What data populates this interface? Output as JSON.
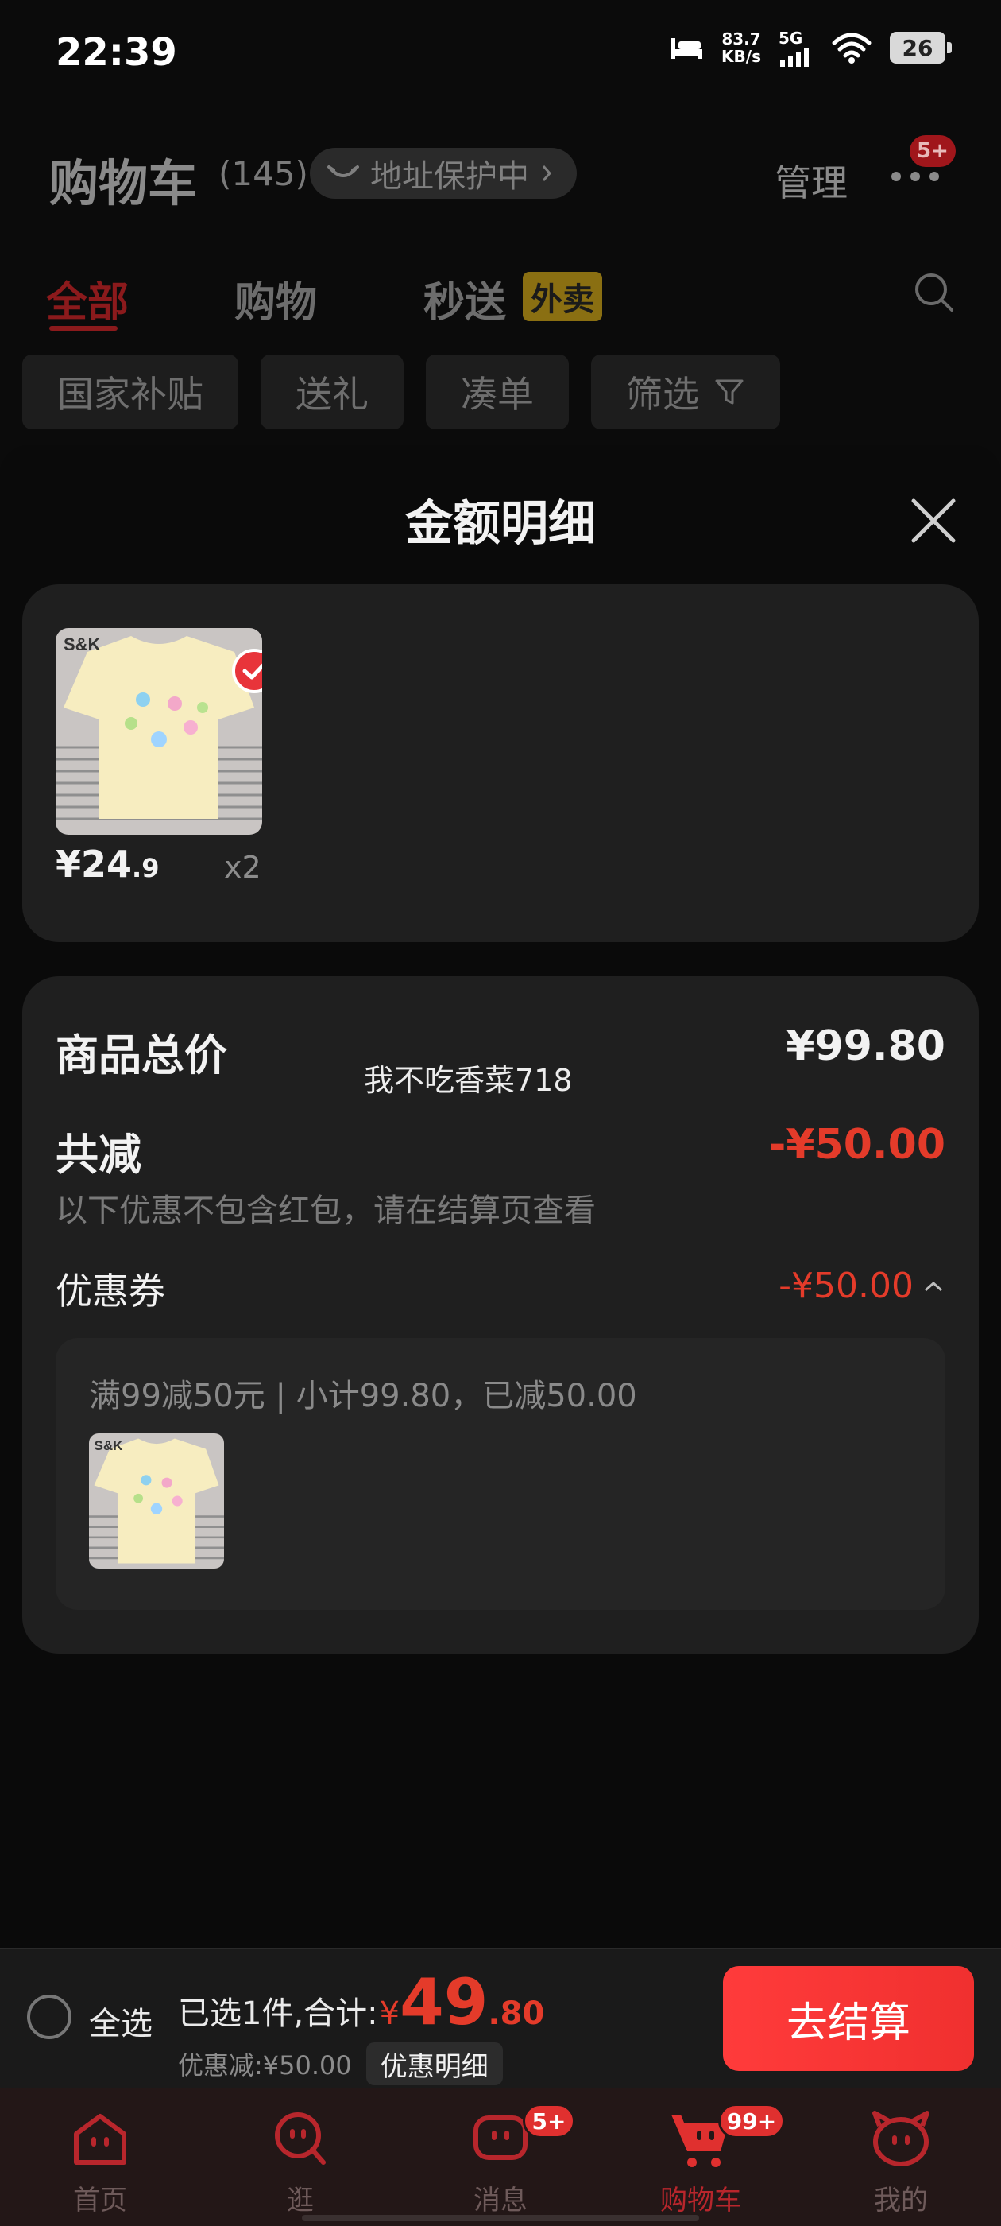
{
  "status_bar": {
    "time": "22:39",
    "net_speed_value": "83.7",
    "net_speed_unit": "KB/s",
    "network": "5G",
    "battery": "26"
  },
  "header": {
    "title": "购物车",
    "count": "(145)",
    "address_protect": "地址保护中",
    "manage": "管理",
    "more_badge": "5+"
  },
  "tabs": [
    {
      "label": "全部",
      "active": true
    },
    {
      "label": "购物"
    },
    {
      "label": "秒送"
    }
  ],
  "takeout_tag": "外卖",
  "filters": [
    "国家补贴",
    "送礼",
    "凑单",
    "筛选"
  ],
  "sheet": {
    "title": "金额明细",
    "product": {
      "brand": "S&K",
      "price_int": "¥24",
      "price_dec": ".9",
      "qty": "x2"
    },
    "total_label": "商品总价",
    "total_value": "¥99.80",
    "watermark": "我不吃香菜718",
    "reduce_label": "共减",
    "reduce_value": "-¥50.00",
    "reduce_note": "以下优惠不包含红包，请在结算页查看",
    "coupon_label": "优惠券",
    "coupon_value": "-¥50.00",
    "coupon_desc": "满99减50元 | 小计99.80，已减50.00"
  },
  "checkout": {
    "select_all": "全选",
    "selected_prefix": "已选1件,合计:",
    "currency": "¥",
    "amount_int": "49",
    "amount_dec": ".80",
    "discount": "优惠减:¥50.00",
    "discount_detail": "优惠明细",
    "checkout_button": "去结算"
  },
  "nav": [
    {
      "label": "首页"
    },
    {
      "label": "逛"
    },
    {
      "label": "消息",
      "badge": "5+"
    },
    {
      "label": "购物车",
      "badge": "99+",
      "active": true
    },
    {
      "label": "我的"
    }
  ],
  "colors": {
    "accent_red": "#e43b2a",
    "button_red": "#ff3b3b",
    "sheet_card": "#1f1f1f",
    "background": "#0b0b0b"
  }
}
